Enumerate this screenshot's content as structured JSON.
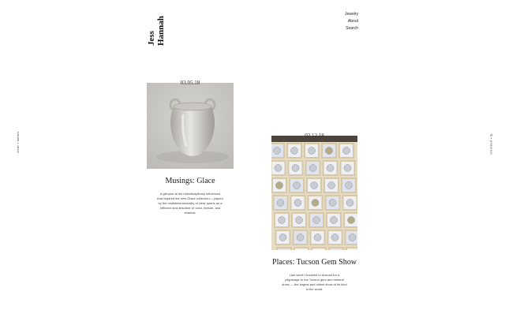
{
  "site": {
    "logo_line1": "Jess",
    "logo_line2": "Hannah"
  },
  "nav": {
    "items": [
      "Jewelry",
      "About",
      "Search"
    ]
  },
  "side": {
    "left": "clear • twitter",
    "right": "fb • pinterest"
  },
  "posts": [
    {
      "date": "03.05.18",
      "title": "Musings: Glace",
      "excerpt": "A glimpse at the interdisciplinary influences that inspired the new Glacé collection— piqued by the multidimensionality of clear quartz as a reflector and absorber of color, texture, and shadow.",
      "image_alt": "clear-quartz-vessel"
    },
    {
      "date": "02.12.18",
      "title": "Places: Tucson Gem Show",
      "excerpt": "Last week I traveled to Arizona for a pilgrimage to the Tucson gem and mineral show — the largest and oldest show of its kind in the world.",
      "image_alt": "pearls-in-display-box"
    }
  ],
  "colors": {
    "background": "#ffffff",
    "text": "#222222"
  }
}
